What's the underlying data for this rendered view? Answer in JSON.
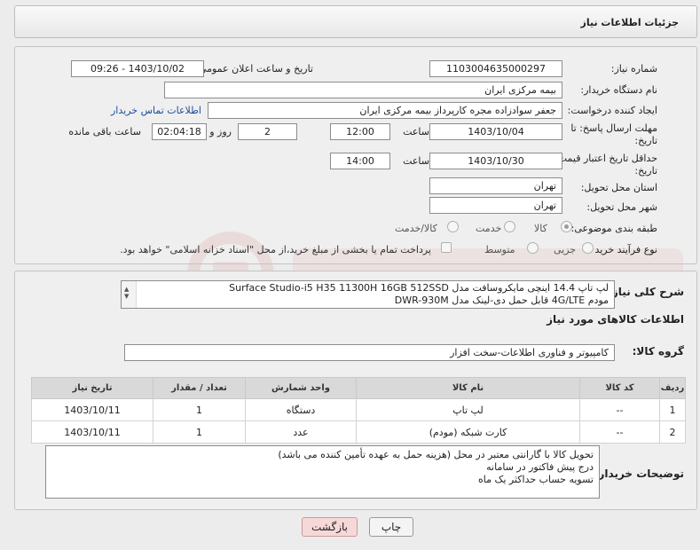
{
  "header": {
    "title": "جزئیات اطلاعات نیاز"
  },
  "need_number": {
    "label": "شماره نیاز:",
    "value": "1103004635000297"
  },
  "announce_datetime": {
    "label": "تاریخ و ساعت اعلان عمومی:",
    "value": "1403/10/02 - 09:26"
  },
  "buyer_org": {
    "label": "نام دستگاه خریدار:",
    "value": "بیمه مرکزی ایران"
  },
  "requester": {
    "label": "ایجاد کننده درخواست:",
    "value": "جعفر سوادزاده مجره کارپرداز بیمه مرکزی ایران",
    "contact_link": "اطلاعات تماس خریدار"
  },
  "reply_deadline": {
    "label_line1": "مهلت ارسال پاسخ: تا",
    "label_line2": "تاریخ:",
    "date": "1403/10/04",
    "time_label": "ساعت",
    "time": "12:00",
    "days": "2",
    "days_label": "روز و",
    "remaining": "02:04:18",
    "remaining_label": "ساعت باقی مانده"
  },
  "price_validity": {
    "label_line1": "حداقل تاریخ اعتبار قیمت: تا",
    "label_line2": "تاریخ:",
    "date": "1403/10/30",
    "time_label": "ساعت",
    "time": "14:00"
  },
  "delivery_province": {
    "label": "استان محل تحویل:",
    "value": "تهران"
  },
  "delivery_city": {
    "label": "شهر محل تحویل:",
    "value": "تهران"
  },
  "category": {
    "label": "طبقه بندی موضوعی:",
    "options": [
      "کالا",
      "خدمت",
      "کالا/خدمت"
    ],
    "selected": "کالا"
  },
  "purchase_process": {
    "label": "نوع فرآیند خرید :",
    "options": [
      "جزیی",
      "متوسط"
    ],
    "payment_note": "پرداخت تمام یا بخشی از مبلغ خرید،از محل \"اسناد خزانه اسلامی\" خواهد بود."
  },
  "summary": {
    "label": "شرح کلی نیاز:",
    "line1": "لپ تاپ 14.4 اینچی مایکروسافت مدل Surface Studio-i5 H35 11300H 16GB 512SSD",
    "line2": "مودم 4G/LTE قابل حمل دی-لینک مدل DWR-930M"
  },
  "goods_section": {
    "title": "اطلاعات کالاهای مورد نیاز"
  },
  "goods_group": {
    "label": "گروه کالا:",
    "value": "کامپیوتر و فناوری اطلاعات-سخت افزار"
  },
  "table": {
    "headers": [
      "ردیف",
      "کد کالا",
      "نام کالا",
      "واحد شمارش",
      "تعداد / مقدار",
      "تاریخ نیاز"
    ],
    "rows": [
      [
        "1",
        "--",
        "لپ تاپ",
        "دستگاه",
        "1",
        "1403/10/11"
      ],
      [
        "2",
        "--",
        "کارت شبکه (مودم)",
        "عدد",
        "1",
        "1403/10/11"
      ]
    ]
  },
  "buyer_notes": {
    "label": "توضیحات خریدار:",
    "lines": [
      "تحویل کالا با گارانتی معتبر در محل (هزینه حمل به عهده تأمین کننده می باشد)",
      "درج پیش فاکتور در سامانه",
      "تسویه حساب حداکثر یک ماه"
    ]
  },
  "buttons": {
    "print": "چاپ",
    "back": "بازگشت"
  },
  "colors": {
    "link": "#1a4fa0",
    "watermark": "#e8b4b4"
  }
}
